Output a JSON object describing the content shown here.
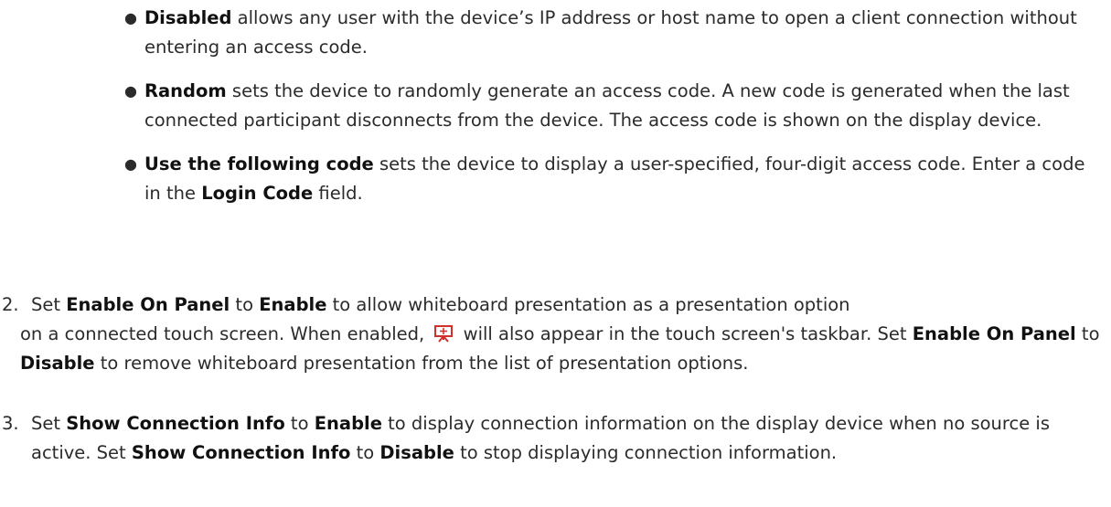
{
  "bullets": [
    {
      "bold": "Disabled",
      "rest": " allows any user with the device’s IP address or host name to open a client connection without entering an access code."
    },
    {
      "bold": "Random",
      "rest": " sets the device to randomly generate an access code. A new code is generated when the last connected participant disconnects from the device. The access code is shown on the display device."
    },
    {
      "bold": "Use the following code",
      "rest_a": " sets the device to display a user-specified, four-digit access code. Enter a code in the ",
      "bold2": "Login Code",
      "rest_b": " field."
    }
  ],
  "step2": {
    "num": "2.",
    "t1": "Set ",
    "b1": "Enable On Panel",
    "t2": " to ",
    "b2": "Enable",
    "t3": " to allow whiteboard presentation as a presentation option",
    "t4": "on a connected touch screen. When enabled, ",
    "icon": "presentation-icon",
    "t5": " will also appear in the touch screen's taskbar. Set ",
    "b3": "Enable On Panel",
    "t6": " to ",
    "b4": "Disable",
    "t7": " to remove whiteboard presentation from the list of presentation options."
  },
  "step3": {
    "num": "3.",
    "t1": "Set ",
    "b1": "Show Connection Info",
    "t2": " to ",
    "b2": "Enable",
    "t3": " to display connection information on the display device when no source is active. Set ",
    "b3": "Show Connection Info",
    "t4": " to ",
    "b4": "Disable",
    "t5": " to stop displaying connection information."
  },
  "colors": {
    "text": "#2b2b2b",
    "icon": "#d0312d"
  }
}
